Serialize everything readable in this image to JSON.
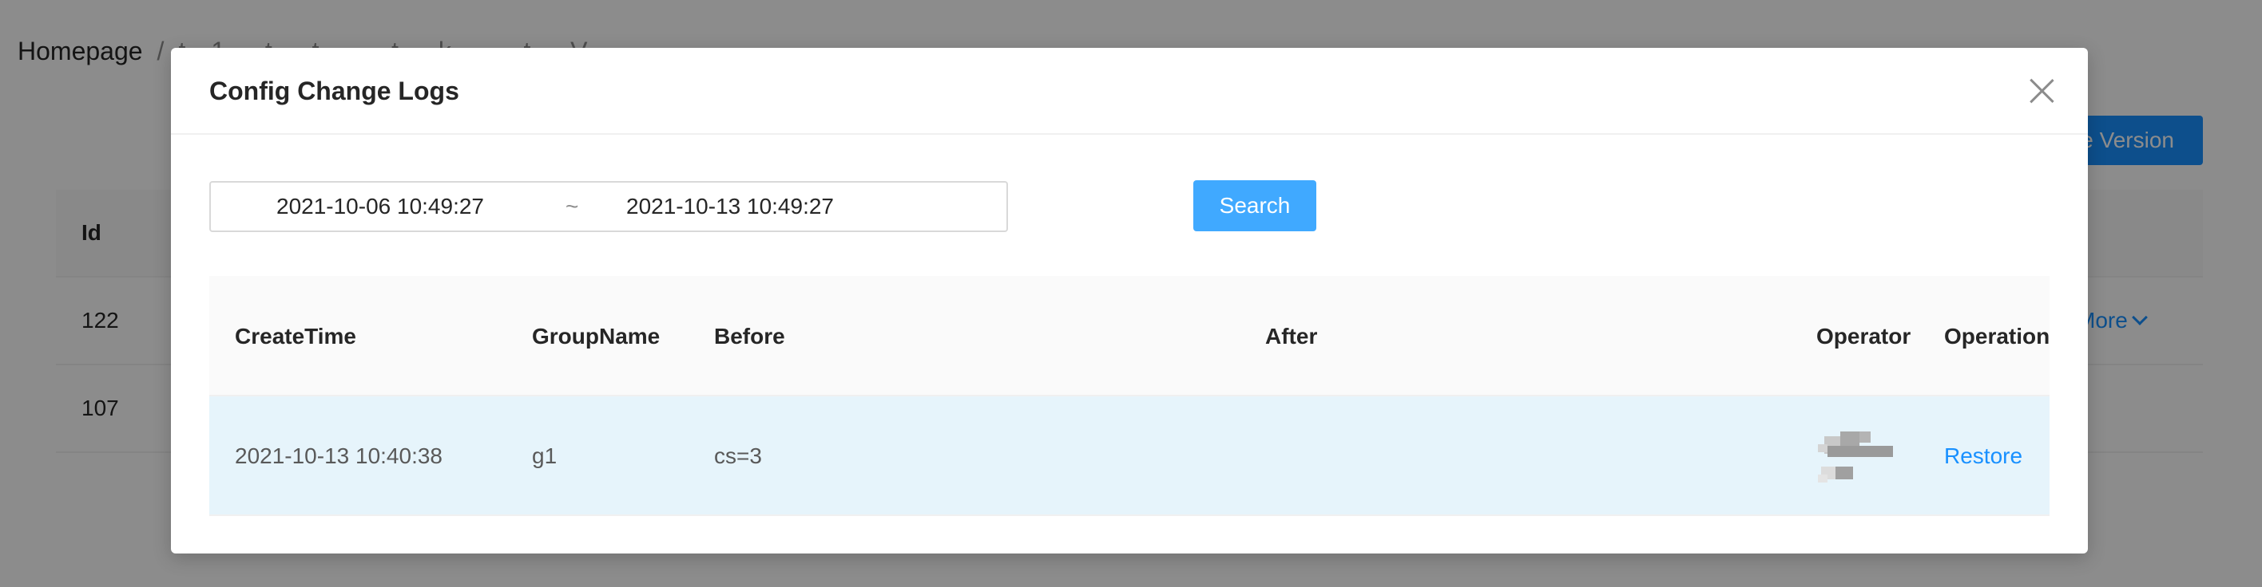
{
  "background": {
    "breadcrumb": {
      "home": "Homepage",
      "separator": "/",
      "rest": "t…1 … t … t … … t … k … … t … V …"
    },
    "create_version_label": "e Version",
    "table": {
      "header_id": "Id",
      "rows": [
        {
          "id": "122",
          "more_label": "More"
        },
        {
          "id": "107"
        }
      ]
    }
  },
  "modal": {
    "title": "Config Change Logs",
    "close_icon": "close-icon",
    "date_range": {
      "start": "2021-10-06 10:49:27",
      "separator": "~",
      "end": "2021-10-13 10:49:27"
    },
    "search_label": "Search",
    "table": {
      "columns": {
        "create_time": "CreateTime",
        "group_name": "GroupName",
        "before": "Before",
        "after": "After",
        "operator": "Operator",
        "operation": "Operation"
      },
      "rows": [
        {
          "create_time": "2021-10-13 10:40:38",
          "group_name": "g1",
          "before": "cs=3",
          "after": "",
          "operator_icon": "blurred-avatar-icon",
          "operation": "Restore"
        }
      ]
    }
  },
  "colors": {
    "primary": "#1890ff",
    "search_button": "#40a9ff",
    "row_highlight": "#e6f4fb",
    "mask": "rgba(0,0,0,0.45)"
  }
}
